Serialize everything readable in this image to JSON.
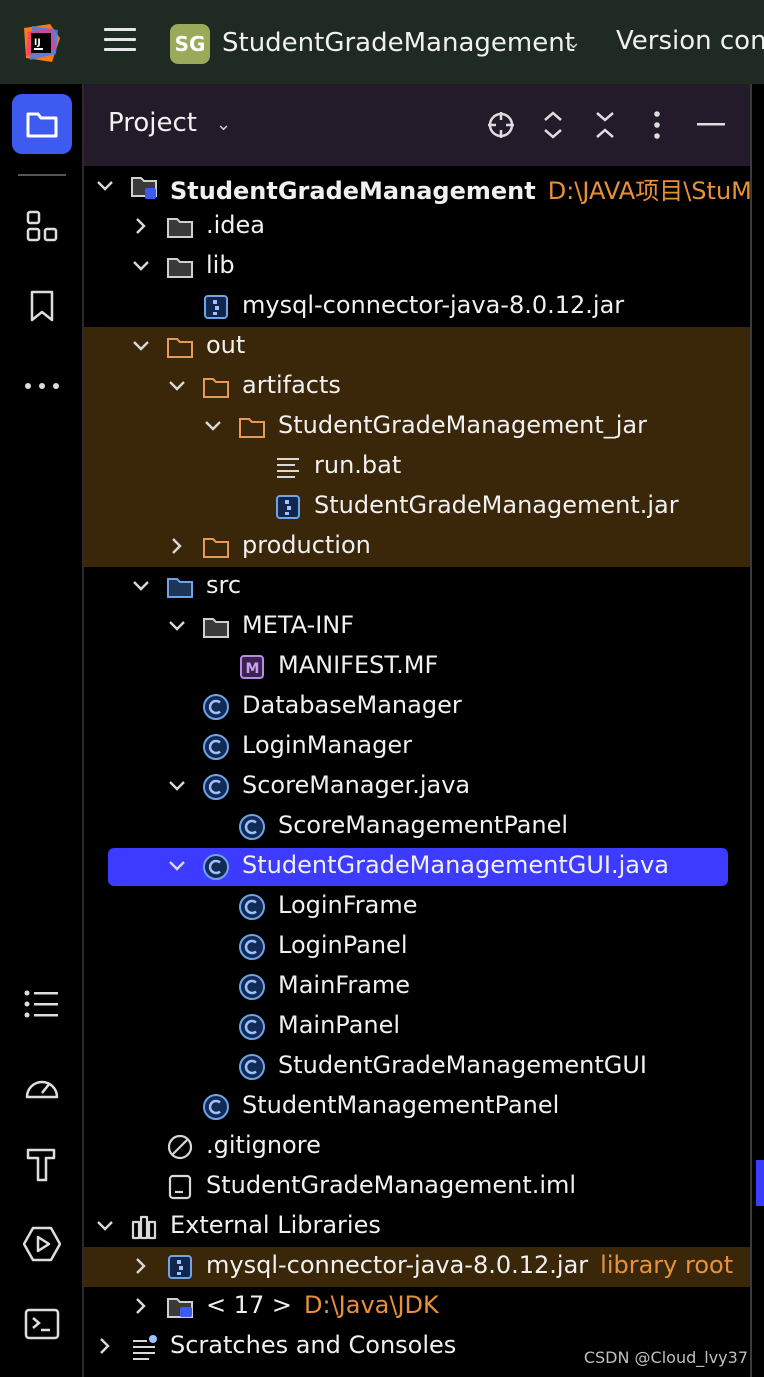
{
  "header": {
    "project_initials": "SG",
    "project_name": "StudentGradeManagement",
    "version_control": "Version con"
  },
  "panel": {
    "title": "Project"
  },
  "tree": [
    {
      "label": "StudentGradeManagement",
      "hint": "D:\\JAVA项目\\StuM",
      "icon": "module-folder-icon",
      "expanded": true
    },
    {
      "label": ".idea",
      "icon": "folder-icon",
      "expanded": false
    },
    {
      "label": "lib",
      "icon": "folder-icon",
      "expanded": true
    },
    {
      "label": "mysql-connector-java-8.0.12.jar",
      "icon": "jar-icon"
    },
    {
      "label": "out",
      "icon": "excluded-folder-icon",
      "expanded": true
    },
    {
      "label": "artifacts",
      "icon": "excluded-folder-icon",
      "expanded": true
    },
    {
      "label": "StudentGradeManagement_jar",
      "icon": "excluded-folder-icon",
      "expanded": true
    },
    {
      "label": "run.bat",
      "icon": "text-file-icon"
    },
    {
      "label": "StudentGradeManagement.jar",
      "icon": "jar-icon"
    },
    {
      "label": "production",
      "icon": "excluded-folder-icon",
      "expanded": false
    },
    {
      "label": "src",
      "icon": "source-folder-icon",
      "expanded": true
    },
    {
      "label": "META-INF",
      "icon": "folder-icon",
      "expanded": true
    },
    {
      "label": "MANIFEST.MF",
      "icon": "manifest-icon"
    },
    {
      "label": "DatabaseManager",
      "icon": "class-icon"
    },
    {
      "label": "LoginManager",
      "icon": "class-icon"
    },
    {
      "label": "ScoreManager.java",
      "icon": "class-icon",
      "expanded": true
    },
    {
      "label": "ScoreManagementPanel",
      "icon": "class-icon"
    },
    {
      "label": "StudentGradeManagementGUI.java",
      "icon": "class-icon",
      "expanded": true
    },
    {
      "label": "LoginFrame",
      "icon": "class-icon"
    },
    {
      "label": "LoginPanel",
      "icon": "class-icon"
    },
    {
      "label": "MainFrame",
      "icon": "class-icon"
    },
    {
      "label": "MainPanel",
      "icon": "class-icon"
    },
    {
      "label": "StudentGradeManagementGUI",
      "icon": "class-icon"
    },
    {
      "label": "StudentManagementPanel",
      "icon": "class-icon"
    },
    {
      "label": ".gitignore",
      "icon": "ignore-file-icon"
    },
    {
      "label": "StudentGradeManagement.iml",
      "icon": "iml-file-icon"
    },
    {
      "label": "External Libraries",
      "icon": "libraries-icon",
      "expanded": true
    },
    {
      "label": "mysql-connector-java-8.0.12.jar",
      "hint": "library root",
      "icon": "jar-icon",
      "expanded": false
    },
    {
      "label": "< 17 >",
      "hint": "D:\\Java\\JDK",
      "icon": "jdk-folder-icon",
      "expanded": false
    },
    {
      "label": "Scratches and Consoles",
      "icon": "scratches-icon",
      "expanded": false
    }
  ],
  "colors": {
    "accent": "#3d5af1",
    "selection": "#3d3bff",
    "excluded_highlight": "#3a2709",
    "hint": "#e8913a"
  },
  "watermark": "CSDN @Cloud_lvy37"
}
